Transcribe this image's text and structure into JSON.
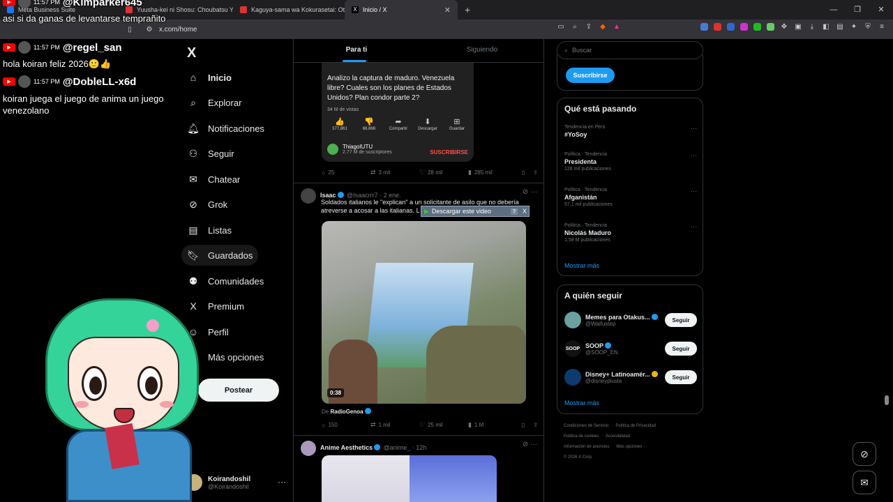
{
  "browser": {
    "tabs": [
      {
        "label": "Meta Business Suite",
        "color": "#1877f2"
      },
      {
        "label": "Yuusha-kei ni Shosu: Choubatsu Yuu",
        "color": "#d33"
      },
      {
        "label": "Kaguya-sama wa Kokurasetai: Otona",
        "color": "#d33"
      },
      {
        "label": "Inicio / X",
        "color": "#fff"
      }
    ],
    "url": "x.com/home",
    "new_tab": "+"
  },
  "nav": {
    "logo": "X",
    "items": [
      {
        "label": "Inicio"
      },
      {
        "label": "Explorar"
      },
      {
        "label": "Notificaciones"
      },
      {
        "label": "Seguir"
      },
      {
        "label": "Chatear"
      },
      {
        "label": "Grok"
      },
      {
        "label": "Listas"
      },
      {
        "label": "Guardados"
      },
      {
        "label": "Comunidades"
      },
      {
        "label": "Premium"
      },
      {
        "label": "Perfil"
      },
      {
        "label": "Más opciones"
      }
    ],
    "post_button": "Postear",
    "account": {
      "name": "Koirandoshil",
      "handle": "@Koirandoshil"
    }
  },
  "timeline": {
    "tabs": [
      {
        "label": "Para ti"
      },
      {
        "label": "Siguiendo"
      }
    ],
    "yt_card": {
      "title": "Analizo la captura de maduro. Venezuela libre? Cuales son los planes de Estados Unidos? Plan condor parte 2?",
      "views": "34 M de vistas",
      "actions": [
        {
          "icon": "👍",
          "label": "377,861"
        },
        {
          "icon": "👎",
          "label": "66,666"
        },
        {
          "icon": "➦",
          "label": "Compartir"
        },
        {
          "icon": "⬇",
          "label": "Descargar"
        },
        {
          "icon": "⊞",
          "label": "Guardar"
        }
      ],
      "channel": "ThiagoIUTU",
      "subscribers": "2.77 M de suscriptores",
      "subscribe": "SUSCRIBIRSE"
    },
    "tweet0_actions": {
      "replies": "25",
      "reposts": "3 mil",
      "likes": "28 mil",
      "views": "285 mil"
    },
    "tweet1": {
      "name": "Isaac",
      "handle": "@Isaacrrr7 · 2 ene.",
      "text": "Soldados italianos le \"explican\" a un solicitante de asilo que no debería atreverse a acosar a las italianas. L",
      "download_bar": "Descargar este video",
      "download_help": "?",
      "download_close": "X",
      "duration": "0:38",
      "source_prefix": "De",
      "source_name": "RadioGenoa",
      "actions": {
        "replies": "150",
        "reposts": "1 mil",
        "likes": "25 mil",
        "views": "1 M"
      }
    },
    "tweet2": {
      "name": "Anime Aesthetics",
      "handle": "@anime_ · 12h"
    }
  },
  "sidebar": {
    "search_placeholder": "Buscar",
    "subscribe": "Suscribirse",
    "trends_title": "Qué está pasando",
    "trends": [
      {
        "context": "Tendencia en Perú",
        "title": "#YoSoy",
        "count": ""
      },
      {
        "context": "Política · Tendencia",
        "title": "Presidenta",
        "count": "128 mil publicaciones"
      },
      {
        "context": "Política · Tendencia",
        "title": "Afganistán",
        "count": "57,1 mil publicaciones"
      },
      {
        "context": "Política · Tendencia",
        "title": "Nicolás Maduro",
        "count": "1,58 M publicaciones"
      }
    ],
    "show_more": "Mostrar más",
    "who_title": "A quién seguir",
    "who": [
      {
        "name": "Memes para Otakus...",
        "handle": "@Waifustep",
        "color": "#6aa0a0"
      },
      {
        "name": "SOOP",
        "handle": "@SOOP_EN",
        "color": "#111"
      },
      {
        "name": "Disney+ Latinoamér...",
        "handle": "@disneyplusla",
        "color": "#0c3b6e"
      }
    ],
    "follow": "Seguir",
    "show_more2": "Mostrar más",
    "footer": [
      "Condiciones de Servicio",
      "Política de Privacidad",
      "Política de cookies",
      "Accesibilidad",
      "Información de anuncios",
      "Más opciones ···",
      "© 2026 X Corp."
    ]
  },
  "chat": {
    "messages": [
      {
        "time": "11:57 PM",
        "user": "@Kimparker645",
        "text": "asi si da ganas de levantarse temprañito"
      },
      {
        "time": "11:57 PM",
        "user": "@regel_san",
        "text": "hola koiran feliz 2026🙂👍"
      },
      {
        "time": "11:57 PM",
        "user": "@DobleLL-x6d",
        "text": "koiran juega el juego de anima un juego venezolano"
      }
    ]
  },
  "colors": {
    "accent": "#1d9bf0",
    "youtube": "#ff0000"
  }
}
